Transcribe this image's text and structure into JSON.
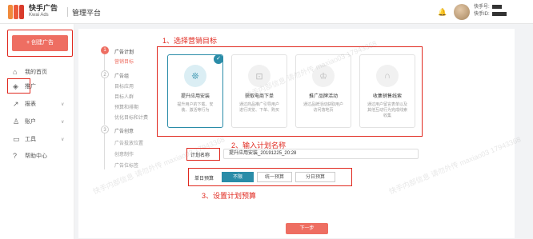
{
  "header": {
    "brand_cn": "快手广告",
    "brand_en": "Kwai Ads",
    "platform": "管理平台",
    "account_line1": "快手号: ",
    "account_line2": "快手ID: ",
    "bell_icon": "bell-icon"
  },
  "sidebar": {
    "create_button": "+ 创建广告",
    "items": [
      {
        "label": "我的首页",
        "icon": "⌂"
      },
      {
        "label": "推广",
        "icon": "◈"
      },
      {
        "label": "报表",
        "icon": "↗",
        "chevron": "∨"
      },
      {
        "label": "账户",
        "icon": "♙",
        "chevron": "∨"
      },
      {
        "label": "工具",
        "icon": "▭",
        "chevron": "∨"
      },
      {
        "label": "帮助中心",
        "icon": "?"
      }
    ]
  },
  "steps": [
    {
      "num": "1",
      "title": "广告计划",
      "subs": [
        "营销目标"
      ]
    },
    {
      "num": "2",
      "title": "广告组",
      "subs": [
        "目标应用",
        "目标人群",
        "预算和排期",
        "优化目标和计费"
      ]
    },
    {
      "num": "3",
      "title": "广告创意",
      "subs": [
        "广告投放位置",
        "创意制作",
        "广告位标签"
      ]
    }
  ],
  "annotations": {
    "a1": "1、选择营销目标",
    "a2": "2、输入计划名称",
    "a3": "3、设置计划预算"
  },
  "goals": [
    {
      "title": "提升应用安装",
      "desc": "提升用户的下载、安装、激活等行为",
      "icon": "❊",
      "selected": true
    },
    {
      "title": "获取电商下单",
      "desc": "通过商品推广引导用户进行浏览、下单、购买",
      "icon": "⊡",
      "selected": false
    },
    {
      "title": "推广品牌活动",
      "desc": "通过品牌活动获取用户访问落地页",
      "icon": "♔",
      "selected": false
    },
    {
      "title": "收集销售线索",
      "desc": "通过用户留言表单以及其他互动行为完成线索收集",
      "icon": "∩",
      "selected": false
    }
  ],
  "plan_name": {
    "label": "计划名称",
    "value": "提升应用安装_20191225_20:28"
  },
  "budget": {
    "label": "单日预算",
    "options": [
      "不限",
      "统一预算",
      "分日预算"
    ],
    "selected": "不限"
  },
  "next_button": "下一步",
  "watermark": "快手内部信息 请勿外传 maxiao03 17943368"
}
